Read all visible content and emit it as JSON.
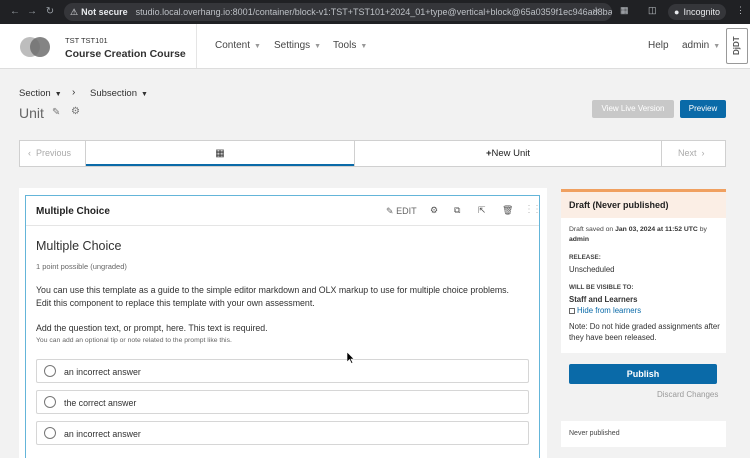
{
  "browser": {
    "security_label": "Not secure",
    "url": "studio.local.overhang.io:8001/container/block-v1:TST+TST101+2024_01+type@vertical+block@65a0359f1ec946ad8ba1bbb7c0...",
    "incognito_label": "Incognito"
  },
  "header": {
    "course_org": "TST TST101",
    "course_title": "Course Creation Course",
    "nav": [
      "Content",
      "Settings",
      "Tools"
    ],
    "help": "Help",
    "user": "admin",
    "debug_toolbar": "DjDT"
  },
  "breadcrumb": {
    "section": "Section",
    "subsection": "Subsection",
    "separator": "›"
  },
  "unit": {
    "title": "Unit",
    "view_live": "View Live Version",
    "preview": "Preview"
  },
  "sequence": {
    "previous": "Previous",
    "new_unit": "New Unit",
    "next": "Next"
  },
  "xblock": {
    "header_title": "Multiple Choice",
    "edit_label": "EDIT",
    "problem_title": "Multiple Choice",
    "points": "1 point possible (ungraded)",
    "description": "You can use this template as a guide to the simple editor markdown and OLX markup to use for multiple choice problems. Edit this component to replace this template with your own assessment.",
    "prompt": "Add the question text, or prompt, here. This text is required.",
    "tip": "You can add an optional tip or note related to the prompt like this.",
    "choices": [
      "an incorrect answer",
      "the correct answer",
      "an incorrect answer"
    ]
  },
  "sidebar": {
    "status_title": "Draft (Never published)",
    "saved_prefix": "Draft saved on",
    "saved_date": "Jan 03, 2024 at 11:52 UTC",
    "saved_by_prefix": "by",
    "saved_by": "admin",
    "release_label": "RELEASE:",
    "release_value": "Unscheduled",
    "visible_label": "WILL BE VISIBLE TO:",
    "visible_value": "Staff and Learners",
    "hide_label": "Hide from learners",
    "note": "Note: Do not hide graded assignments after they have been released.",
    "publish": "Publish",
    "discard": "Discard Changes",
    "never_published": "Never published"
  },
  "colors": {
    "primary": "#0a6aa8",
    "draft_border": "#f0a060",
    "draft_bg": "#fbeee5"
  }
}
